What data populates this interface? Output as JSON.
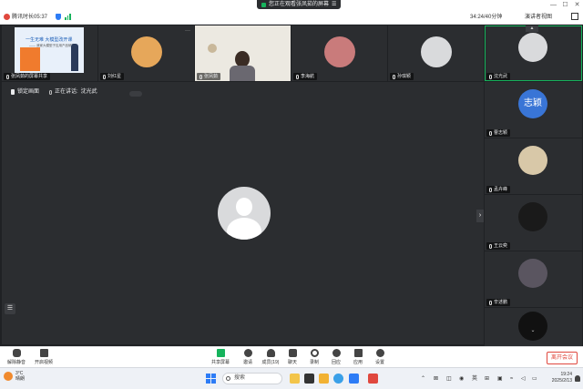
{
  "titlebar": {
    "share_banner": "您正在观看张凤茹的屏幕",
    "banner_menu_icon": "menu-icon",
    "window_controls": [
      "—",
      "☐",
      "✕"
    ]
  },
  "inforow": {
    "duration": "腾讯时长05:37",
    "timer": "34:24/40分钟",
    "view_button": "演讲者视图"
  },
  "gallery": [
    {
      "name": "张凤茹的屏幕共享",
      "type": "screen-share",
      "slide_title": "一生无难 大模型改开课",
      "slide_sub": "—— 我家大模型子应用产品研究",
      "slide_logo": "北大赢家"
    },
    {
      "name": "刘红星",
      "type": "avatar-cat"
    },
    {
      "name": "张凤茹",
      "type": "camera-room"
    },
    {
      "name": "李海航",
      "type": "avatar-photo"
    },
    {
      "name": "孙琪颖",
      "type": "default-avatar"
    }
  ],
  "stage": {
    "pin_button": "锁定画面",
    "speaking_label": "正在讲话:",
    "speaker_name": "沈光武",
    "side_arrow": "›",
    "list_button": "☰"
  },
  "rail": [
    {
      "name": "沈光武",
      "type": "default",
      "active": true
    },
    {
      "name": "曹志颖",
      "type": "text",
      "text": "志颖"
    },
    {
      "name": "孟卉峰",
      "type": "photo"
    },
    {
      "name": "王云奕",
      "type": "photo"
    },
    {
      "name": "辛述鹏",
      "type": "photo"
    },
    {
      "name": "",
      "type": "photo"
    }
  ],
  "toolbar": {
    "items": [
      {
        "label": "解除静音",
        "icon": "mic-off-icon"
      },
      {
        "label": "开启视频",
        "icon": "video-off-icon"
      },
      {
        "label": "共享屏幕",
        "icon": "share-screen-icon"
      },
      {
        "label": "邀请",
        "icon": "invite-icon"
      },
      {
        "label": "成员(19)",
        "icon": "members-icon"
      },
      {
        "label": "聊天",
        "icon": "chat-icon"
      },
      {
        "label": "录制",
        "icon": "record-icon"
      },
      {
        "label": "回应",
        "icon": "reaction-icon"
      },
      {
        "label": "应用",
        "icon": "apps-icon"
      },
      {
        "label": "设置",
        "icon": "settings-icon"
      }
    ],
    "leave": "离开会议"
  },
  "taskbar": {
    "weather_temp": "3°C",
    "weather_desc": "晴朗",
    "search_placeholder": "搜索",
    "tray_lang": "英",
    "time": "19:24",
    "date": "2025/2/13"
  },
  "colors": {
    "accent_green": "#16b35c",
    "leave_red": "#e0483e",
    "avatar_blue": "#3975d6"
  }
}
